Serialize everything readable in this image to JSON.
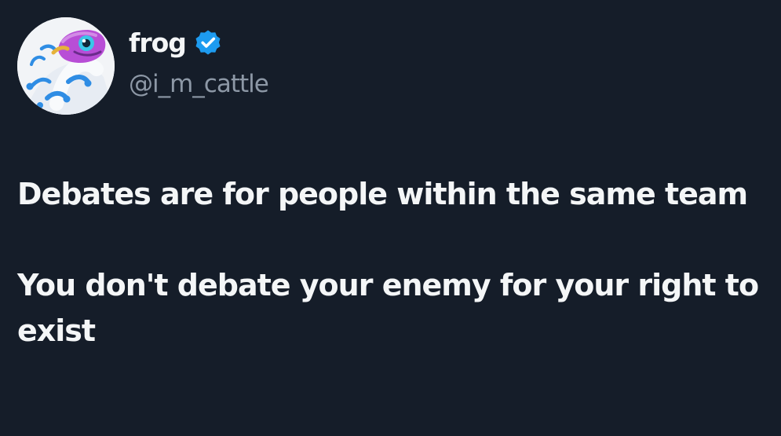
{
  "author": {
    "display_name": "frog",
    "handle": "@i_m_cattle",
    "verified_icon": "verified-badge-icon",
    "avatar_icon": "frog-avatar-icon",
    "badge_color": "#1d9bf0"
  },
  "tweet": {
    "paragraphs": [
      "Debates are for people within the same team",
      "You don't debate your enemy for your right to exist"
    ]
  },
  "colors": {
    "background": "#151d29",
    "text_primary": "#f4f6f7",
    "text_secondary": "#8d98a6"
  }
}
